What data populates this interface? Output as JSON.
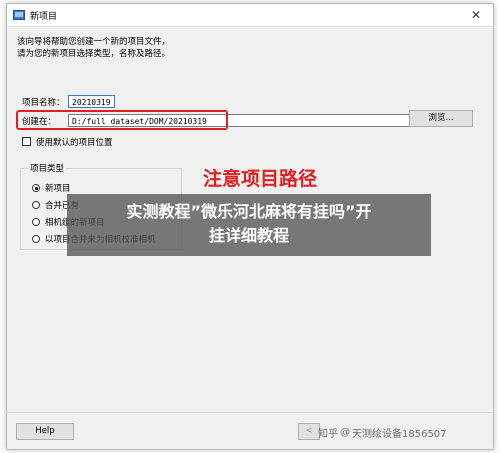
{
  "window": {
    "title": "新项目",
    "close_glyph": "✕"
  },
  "description": {
    "line1": "该向导将帮助您创建一个新的项目文件，",
    "line2": "请为您的新项目选择类型，名称及路径。"
  },
  "project_name": {
    "label": "项目名称：",
    "value": "20210319"
  },
  "create_in": {
    "label": "创建在：",
    "value": "D:/full dataset/DOM/20210319",
    "browse_label": "浏览..."
  },
  "default_location": {
    "label": "使用默认的项目位置",
    "checked": false
  },
  "project_type": {
    "title": "项目类型",
    "options": [
      {
        "label": "新项目",
        "selected": true
      },
      {
        "label": "合并已有",
        "selected": false
      },
      {
        "label": "相机组的新项目",
        "selected": false
      },
      {
        "label": "以项目合并来为相机校准相机",
        "selected": false
      }
    ]
  },
  "annotation": {
    "text": "注意项目路径"
  },
  "banner": {
    "line1": "实测教程”微乐河北麻将有挂吗”开",
    "line2": "挂详细教程"
  },
  "footer": {
    "help_label": "Help",
    "watermark_brand": "知乎",
    "watermark_at": "@",
    "watermark_user": "天测绘设备1856507",
    "back_label": "<"
  },
  "colors": {
    "accent_red": "#e02020",
    "window_bg": "#f0f0f0"
  }
}
